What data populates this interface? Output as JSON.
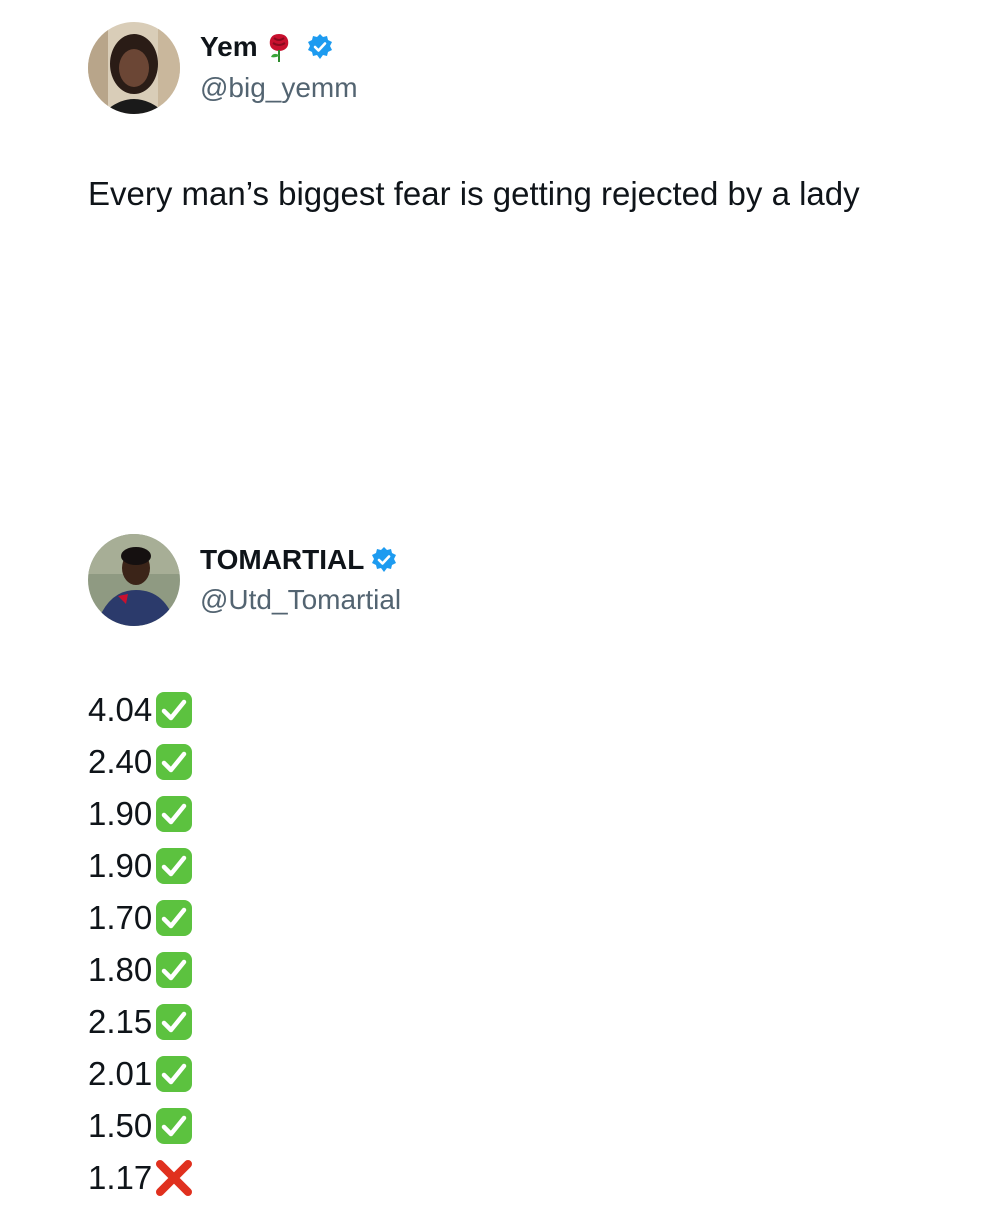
{
  "tweets": [
    {
      "display_name": "Yem",
      "name_emoji": "rose-icon",
      "verified": true,
      "handle": "@big_yemm",
      "text": "Every man’s biggest fear is getting rejected by a lady"
    },
    {
      "display_name": "TOMARTIAL",
      "verified": true,
      "handle": "@Utd_Tomartial",
      "odds": [
        {
          "value": "4.04",
          "result": "check"
        },
        {
          "value": "2.40",
          "result": "check"
        },
        {
          "value": "1.90",
          "result": "check"
        },
        {
          "value": "1.90",
          "result": "check"
        },
        {
          "value": "1.70",
          "result": "check"
        },
        {
          "value": "1.80",
          "result": "check"
        },
        {
          "value": "2.15",
          "result": "check"
        },
        {
          "value": "2.01",
          "result": "check"
        },
        {
          "value": "1.50",
          "result": "check"
        },
        {
          "value": "1.17",
          "result": "cross"
        }
      ]
    }
  ],
  "colors": {
    "verified_blue": "#1d9bf0",
    "check_green": "#5cc23f",
    "cross_red": "#e0301e",
    "handle_gray": "#536471"
  }
}
